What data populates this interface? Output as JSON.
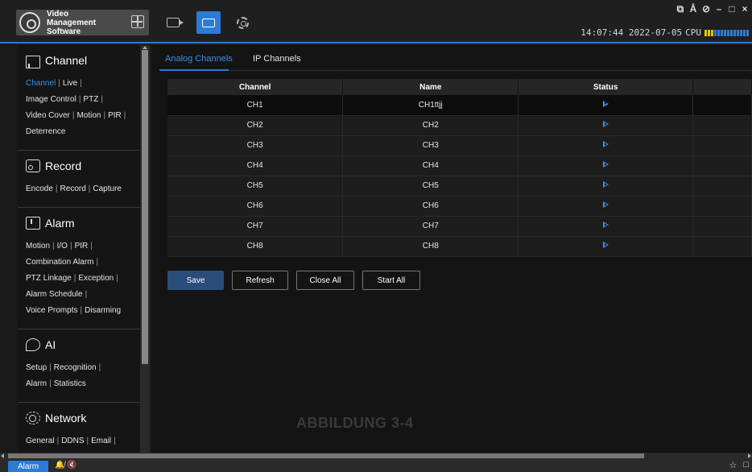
{
  "app": {
    "brand_text": "Video Management Software",
    "time": "14:07:44 2022-07-05",
    "cpu_label": "CPU",
    "cpu_usage_fraction": 0.2,
    "window_controls": [
      "⧉",
      "Å",
      "⊘",
      "–",
      "□",
      "×"
    ]
  },
  "nav": {
    "icons": [
      "grid-icon",
      "camera-icon",
      "keyboard-icon",
      "settings-icon"
    ],
    "active": "keyboard-icon"
  },
  "sidebar": {
    "channel": {
      "title": "Channel",
      "lines": [
        [
          "Channel",
          "Live"
        ],
        [
          "Image Control",
          "PTZ"
        ],
        [
          "Video Cover",
          "Motion",
          "PIR"
        ],
        [
          "Deterrence"
        ]
      ]
    },
    "record": {
      "title": "Record",
      "lines": [
        [
          "Encode",
          "Record",
          "Capture"
        ]
      ]
    },
    "alarm": {
      "title": "Alarm",
      "lines": [
        [
          "Motion",
          "I/O",
          "PIR"
        ],
        [
          "Combination Alarm"
        ],
        [
          "PTZ Linkage",
          "Exception"
        ],
        [
          "Alarm Schedule"
        ],
        [
          "Voice Prompts",
          "Disarming"
        ]
      ]
    },
    "ai": {
      "title": "AI",
      "lines": [
        [
          "Setup",
          "Recognition"
        ],
        [
          "Alarm",
          "Statistics"
        ]
      ]
    },
    "network": {
      "title": "Network",
      "lines": [
        [
          "General",
          "DDNS",
          "Email"
        ]
      ]
    },
    "active_link": "Channel"
  },
  "tabs": [
    {
      "label": "Analog Channels",
      "active": true
    },
    {
      "label": "IP Channels",
      "active": false
    }
  ],
  "table": {
    "headers": [
      "Channel",
      "Name",
      "Status",
      ""
    ],
    "rows": [
      {
        "channel": "CH1",
        "name": "CH1ttjj",
        "status": "play"
      },
      {
        "channel": "CH2",
        "name": "CH2",
        "status": "play"
      },
      {
        "channel": "CH3",
        "name": "CH3",
        "status": "play"
      },
      {
        "channel": "CH4",
        "name": "CH4",
        "status": "play"
      },
      {
        "channel": "CH5",
        "name": "CH5",
        "status": "play"
      },
      {
        "channel": "CH6",
        "name": "CH6",
        "status": "play"
      },
      {
        "channel": "CH7",
        "name": "CH7",
        "status": "play"
      },
      {
        "channel": "CH8",
        "name": "CH8",
        "status": "play"
      }
    ],
    "selected_row": 0
  },
  "buttons": {
    "save": "Save",
    "refresh": "Refresh",
    "close_all": "Close All",
    "start_all": "Start All"
  },
  "watermark": "ABBILDUNG 3-4",
  "taskbar": {
    "alarm_tab": "Alarm",
    "icons": "🔔̸ 🔇",
    "right": [
      "☆",
      "□"
    ]
  },
  "colors": {
    "accent": "#2c7bd6",
    "active_link": "#3c8ee8",
    "background": "#141414",
    "cpu_used": "#e8c400"
  }
}
